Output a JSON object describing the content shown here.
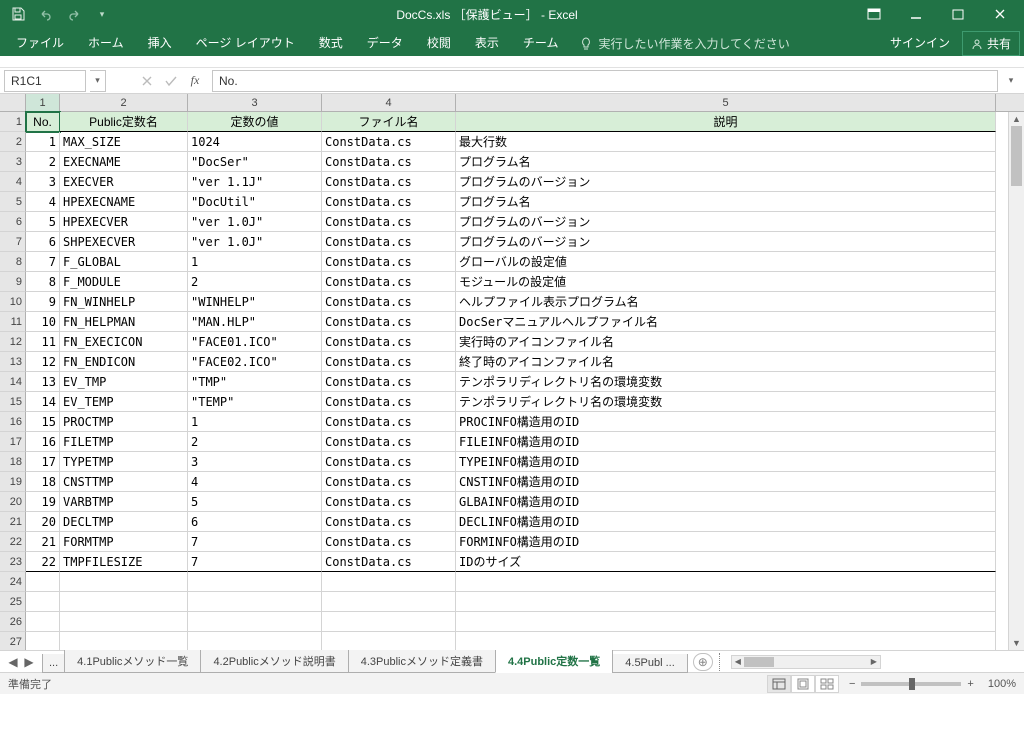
{
  "title": "DocCs.xls ［保護ビュー］ - Excel",
  "ribbon_tabs": [
    "ファイル",
    "ホーム",
    "挿入",
    "ページ レイアウト",
    "数式",
    "データ",
    "校閲",
    "表示",
    "チーム"
  ],
  "tell_me": "実行したい作業を入力してください",
  "signin": "サインイン",
  "share": "共有",
  "name_box": "R1C1",
  "formula": "No.",
  "col_headers": [
    "1",
    "2",
    "3",
    "4",
    "5"
  ],
  "headers": {
    "no": "No.",
    "name": "Public定数名",
    "value": "定数の値",
    "file": "ファイル名",
    "desc": "説明"
  },
  "rows": [
    {
      "no": "1",
      "name": "MAX_SIZE",
      "value": "1024",
      "file": "ConstData.cs",
      "desc": "最大行数"
    },
    {
      "no": "2",
      "name": "EXECNAME",
      "value": "\"DocSer\"",
      "file": "ConstData.cs",
      "desc": "プログラム名"
    },
    {
      "no": "3",
      "name": "EXECVER",
      "value": "\"ver 1.1J\"",
      "file": "ConstData.cs",
      "desc": "プログラムのバージョン"
    },
    {
      "no": "4",
      "name": "HPEXECNAME",
      "value": "\"DocUtil\"",
      "file": "ConstData.cs",
      "desc": "プログラム名"
    },
    {
      "no": "5",
      "name": "HPEXECVER",
      "value": "\"ver 1.0J\"",
      "file": "ConstData.cs",
      "desc": "プログラムのバージョン"
    },
    {
      "no": "6",
      "name": "SHPEXECVER",
      "value": "\"ver 1.0J\"",
      "file": "ConstData.cs",
      "desc": "プログラムのバージョン"
    },
    {
      "no": "7",
      "name": "F_GLOBAL",
      "value": "1",
      "file": "ConstData.cs",
      "desc": "グローバルの設定値"
    },
    {
      "no": "8",
      "name": "F_MODULE",
      "value": "2",
      "file": "ConstData.cs",
      "desc": "モジュールの設定値"
    },
    {
      "no": "9",
      "name": "FN_WINHELP",
      "value": "\"WINHELP\"",
      "file": "ConstData.cs",
      "desc": "ヘルプファイル表示プログラム名"
    },
    {
      "no": "10",
      "name": "FN_HELPMAN",
      "value": "\"MAN.HLP\"",
      "file": "ConstData.cs",
      "desc": "DocSerマニュアルヘルプファイル名"
    },
    {
      "no": "11",
      "name": "FN_EXECICON",
      "value": "\"FACE01.ICO\"",
      "file": "ConstData.cs",
      "desc": "実行時のアイコンファイル名"
    },
    {
      "no": "12",
      "name": "FN_ENDICON",
      "value": "\"FACE02.ICO\"",
      "file": "ConstData.cs",
      "desc": "終了時のアイコンファイル名"
    },
    {
      "no": "13",
      "name": "EV_TMP",
      "value": "\"TMP\"",
      "file": "ConstData.cs",
      "desc": "テンポラリディレクトリ名の環境変数"
    },
    {
      "no": "14",
      "name": "EV_TEMP",
      "value": "\"TEMP\"",
      "file": "ConstData.cs",
      "desc": "テンポラリディレクトリ名の環境変数"
    },
    {
      "no": "15",
      "name": "PROCTMP",
      "value": "1",
      "file": "ConstData.cs",
      "desc": "PROCINFO構造用のID"
    },
    {
      "no": "16",
      "name": "FILETMP",
      "value": "2",
      "file": "ConstData.cs",
      "desc": "FILEINFO構造用のID"
    },
    {
      "no": "17",
      "name": "TYPETMP",
      "value": "3",
      "file": "ConstData.cs",
      "desc": "TYPEINFO構造用のID"
    },
    {
      "no": "18",
      "name": "CNSTTMP",
      "value": "4",
      "file": "ConstData.cs",
      "desc": "CNSTINFO構造用のID"
    },
    {
      "no": "19",
      "name": "VARBTMP",
      "value": "5",
      "file": "ConstData.cs",
      "desc": "GLBAINFO構造用のID"
    },
    {
      "no": "20",
      "name": "DECLTMP",
      "value": "6",
      "file": "ConstData.cs",
      "desc": "DECLINFO構造用のID"
    },
    {
      "no": "21",
      "name": "FORMTMP",
      "value": "7",
      "file": "ConstData.cs",
      "desc": "FORMINFO構造用のID"
    },
    {
      "no": "22",
      "name": "TMPFILESIZE",
      "value": "7",
      "file": "ConstData.cs",
      "desc": "IDのサイズ"
    }
  ],
  "empty_rows": [
    "24",
    "25",
    "26",
    "27"
  ],
  "sheet_tabs": {
    "ellipsis": "...",
    "tabs": [
      "4.1Publicメソッド一覧",
      "4.2Publicメソッド説明書",
      "4.3Publicメソッド定義書",
      "4.4Public定数一覧",
      "4.5Publ ..."
    ],
    "active_index": 3
  },
  "status": {
    "ready": "準備完了",
    "zoom": "100%"
  }
}
